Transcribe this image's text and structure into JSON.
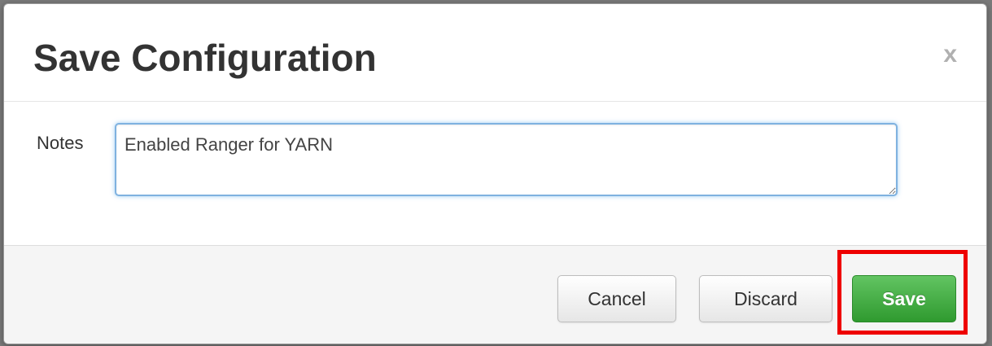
{
  "dialog": {
    "title": "Save Configuration",
    "close_label": "x"
  },
  "form": {
    "notes_label": "Notes",
    "notes_value": "Enabled Ranger for YARN"
  },
  "footer": {
    "cancel_label": "Cancel",
    "discard_label": "Discard",
    "save_label": "Save"
  },
  "colors": {
    "save_button": "#3aa83a",
    "highlight_box": "#ee0000",
    "input_focus": "#7fb2e0"
  }
}
